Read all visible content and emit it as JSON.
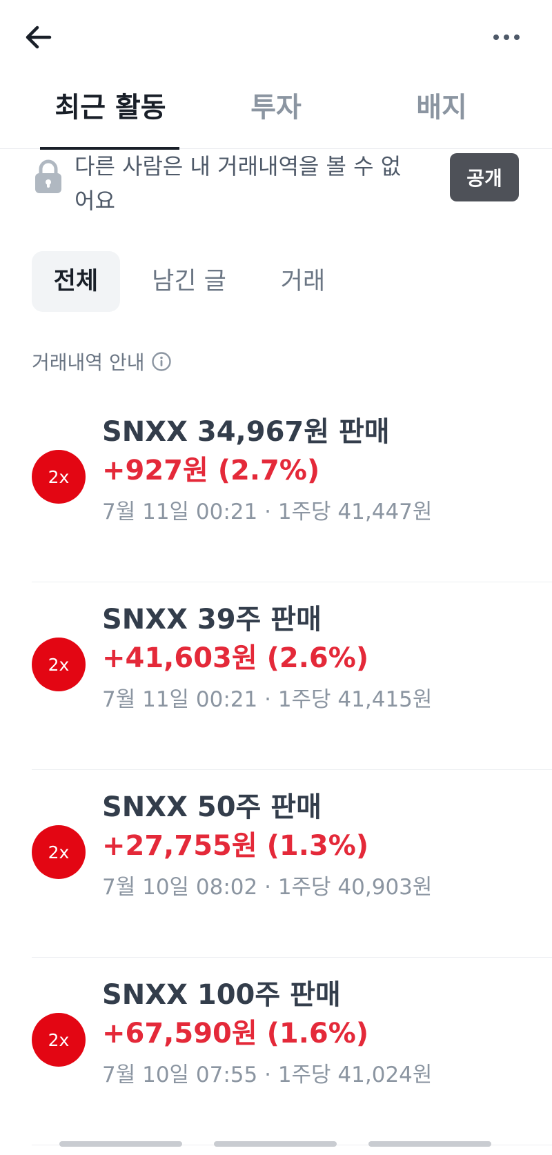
{
  "header": {
    "back_icon": "arrow-left-icon",
    "more_icon": "more-horizontal-icon"
  },
  "tabs": [
    {
      "label": "최근 활동",
      "active": true
    },
    {
      "label": "투자",
      "active": false
    },
    {
      "label": "배지",
      "active": false
    }
  ],
  "notice": {
    "icon": "lock-icon",
    "text": "다른 사람은 내 거래내역을 볼 수 없어요",
    "button_label": "공개"
  },
  "filters": [
    {
      "label": "전체",
      "active": true
    },
    {
      "label": "남긴 글",
      "active": false
    },
    {
      "label": "거래",
      "active": false
    }
  ],
  "section": {
    "label": "거래내역 안내",
    "icon": "info-icon"
  },
  "colors": {
    "badge": "#e30613",
    "profit": "#e42939",
    "button": "#4e5158"
  },
  "activities": [
    {
      "badge": "2x",
      "title": "SNXX 34,967원 판매",
      "profit": "+927원 (2.7%)",
      "meta": "7월 11일 00:21 · 1주당 41,447원"
    },
    {
      "badge": "2x",
      "title": "SNXX 39주 판매",
      "profit": "+41,603원 (2.6%)",
      "meta": "7월 11일 00:21 · 1주당 41,415원"
    },
    {
      "badge": "2x",
      "title": "SNXX 50주 판매",
      "profit": "+27,755원 (1.3%)",
      "meta": "7월 10일 08:02 · 1주당 40,903원"
    },
    {
      "badge": "2x",
      "title": "SNXX 100주 판매",
      "profit": "+67,590원 (1.6%)",
      "meta": "7월 10일 07:55 · 1주당 41,024원"
    }
  ]
}
